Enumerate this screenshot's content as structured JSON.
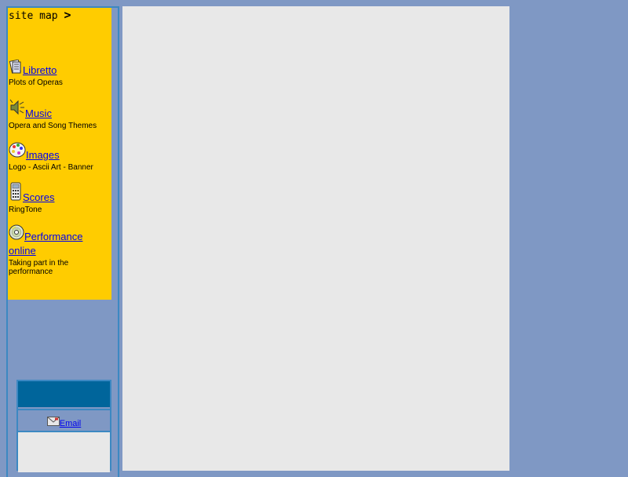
{
  "sidebar": {
    "site_map_label": "site map",
    "site_map_arrow": ">",
    "items": [
      {
        "label": "Libretto",
        "description": "Plots of Operas",
        "icon": "book-icon"
      },
      {
        "label": "Music",
        "description": "Opera and Song Themes",
        "icon": "speaker-icon"
      },
      {
        "label": "Images",
        "description": "Logo - Ascii Art - Banner",
        "icon": "palette-icon"
      },
      {
        "label": "Scores",
        "description": "RingTone",
        "icon": "phone-icon"
      },
      {
        "label": "Performance online",
        "description": "Taking part in the performance",
        "icon": "cd-icon"
      }
    ]
  },
  "contact": {
    "email_label": "Email",
    "icon": "envelope-icon"
  },
  "colors": {
    "background": "#7f98c4",
    "panel": "#ffcc00",
    "content": "#e8e8e8",
    "border": "#3c88c2",
    "header": "#00659b",
    "link": "#0000ee"
  }
}
